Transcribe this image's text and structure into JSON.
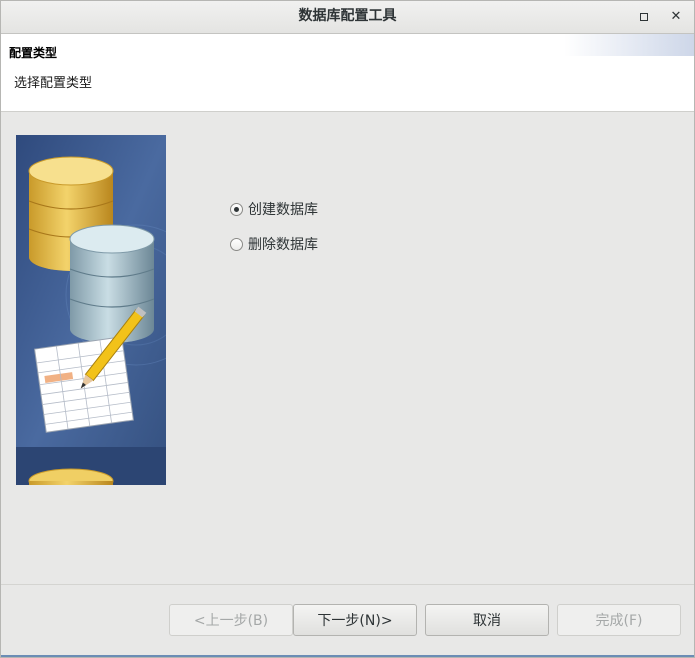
{
  "window": {
    "title": "数据库配置工具"
  },
  "header": {
    "title": "配置类型",
    "subtitle": "选择配置类型"
  },
  "options": [
    {
      "label": "创建数据库",
      "checked": true
    },
    {
      "label": "删除数据库",
      "checked": false
    }
  ],
  "buttons": {
    "back": "<上一步(B)",
    "next": "下一步(N)>",
    "cancel": "取消",
    "finish": "完成(F)"
  },
  "icons": {
    "maximize": "maximize-icon",
    "close": "close-icon",
    "illustration": "database-illustration"
  },
  "colors": {
    "illustration_bg": "#3f5c8f",
    "accent": "#6b8db5"
  }
}
